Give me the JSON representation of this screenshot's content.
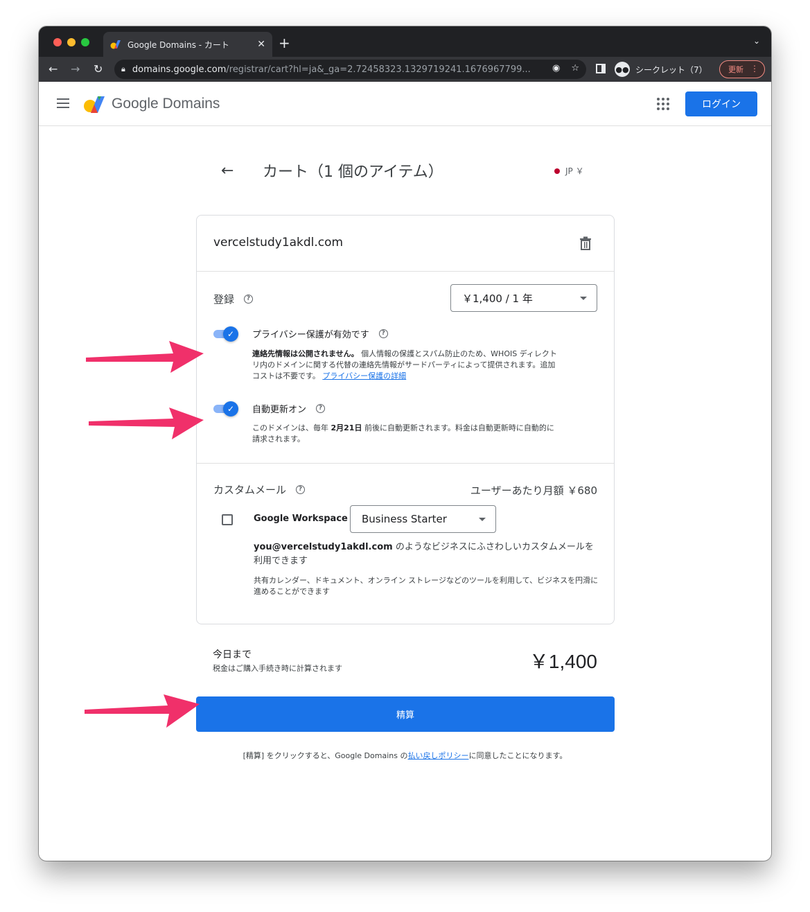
{
  "browser": {
    "tab_title": "Google Domains - カート",
    "url_host": "domains.google.com",
    "url_path": "/registrar/cart?hl=ja&_ga=2.72458323.1329719241.1676967799...",
    "incognito_label": "シークレット（7）",
    "update_label": "更新",
    "traffic_lights": [
      "#ff5f57",
      "#febc2e",
      "#28c840"
    ]
  },
  "header": {
    "brand": "Google Domains",
    "login_label": "ログイン",
    "accent": "#1a73e8"
  },
  "page": {
    "title": "カート（1 個のアイテム）",
    "currency": "JP ￥"
  },
  "cart": {
    "domain": "vercelstudy1akdl.com",
    "registration": {
      "label": "登録",
      "selected_term": "￥1,400 / 1 年"
    },
    "privacy": {
      "title": "プライバシー保護が有効です",
      "desc_bold": "連絡先情報は公開されません。",
      "desc_text": " 個人情報の保護とスパム防止のため、WHOIS ディレクトリ内のドメインに関する代替の連絡先情報がサードパーティによって提供されます。追加コストは不要です。",
      "link": "プライバシー保護の詳細",
      "enabled": true
    },
    "autorenew": {
      "title": "自動更新オン",
      "desc_pre": "このドメインは、毎年 ",
      "desc_date": "2月21日",
      "desc_post": " 前後に自動更新されます。料金は自動更新時に自動的に請求されます。",
      "enabled": true
    },
    "custom_mail": {
      "label": "カスタムメール",
      "price": "ユーザーあたり月額 ￥680",
      "product": "Google Workspace",
      "plan": "Business Starter",
      "checked": false,
      "desc_email": "you@vercelstudy1akdl.com",
      "desc_1": " のようなビジネスにふさわしいカスタムメールを利用できます",
      "desc_2": "共有カレンダー、ドキュメント、オンライン ストレージなどのツールを利用して、ビジネスを円滑に進めることができます"
    }
  },
  "total": {
    "label": "今日まで",
    "note": "税金はご購入手続き時に計算されます",
    "amount": "￥1,400"
  },
  "checkout": {
    "button_label": "精算",
    "policy_pre": "[精算] をクリックすると、Google Domains の",
    "policy_link": "払い戻しポリシー",
    "policy_post": "に同意したことになります。"
  },
  "annotations": {
    "arrow_color": "#f0306a"
  }
}
